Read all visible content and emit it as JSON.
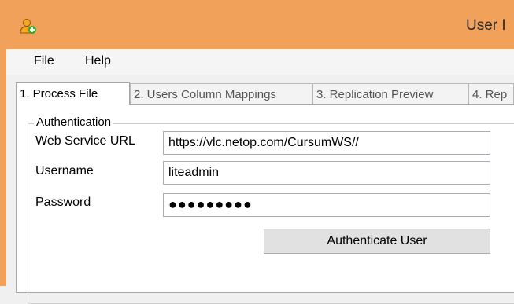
{
  "window": {
    "title": "User I",
    "app_icon": "user-add-icon"
  },
  "menu": {
    "items": [
      {
        "label": "File"
      },
      {
        "label": "Help"
      }
    ]
  },
  "tabs": [
    {
      "label": "1. Process File",
      "active": true
    },
    {
      "label": "2. Users Column Mappings",
      "active": false
    },
    {
      "label": "3. Replication Preview",
      "active": false
    },
    {
      "label": "4. Rep",
      "active": false
    }
  ],
  "authentication": {
    "group_label": "Authentication",
    "url_label": "Web Service URL",
    "url_value": "https://vlc.netop.com/CursumWS//",
    "username_label": "Username",
    "username_value": "liteadmin",
    "password_label": "Password",
    "password_value": "●●●●●●●●●",
    "button_label": "Authenticate User"
  },
  "colors": {
    "titlebar": "#f2a15a",
    "accent_icon": "#f5a623",
    "plus_icon": "#2eaa2e"
  }
}
